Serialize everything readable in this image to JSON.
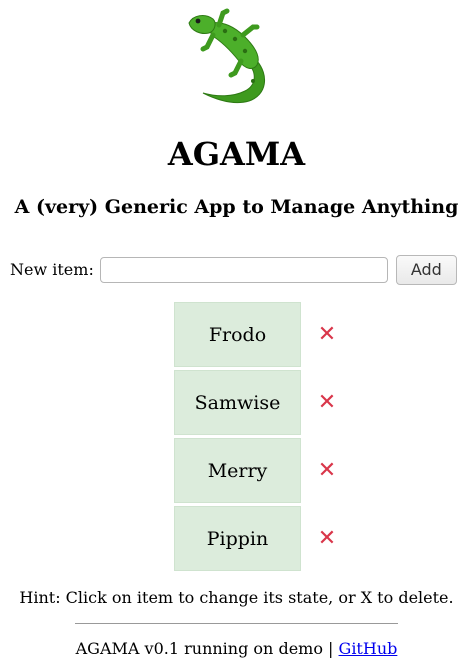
{
  "app": {
    "logo_icon": "lizard-icon",
    "title": "AGAMA",
    "subtitle": "A (very) Generic App to Manage Anything"
  },
  "new_item": {
    "label": "New item:",
    "input_value": "",
    "input_placeholder": "",
    "add_button_label": "Add"
  },
  "items": [
    {
      "name": "Frodo",
      "delete_label": "✕"
    },
    {
      "name": "Samwise",
      "delete_label": "✕"
    },
    {
      "name": "Merry",
      "delete_label": "✕"
    },
    {
      "name": "Pippin",
      "delete_label": "✕"
    }
  ],
  "hint": "Hint: Click on item to change its state, or X to delete.",
  "footer": {
    "text": "AGAMA v0.1 running on demo | ",
    "link_label": "GitHub"
  },
  "colors": {
    "item_background": "#dcecdc",
    "delete_icon": "#d9364a",
    "lizard_green": "#3e9a1e",
    "link": "#0000ee"
  }
}
